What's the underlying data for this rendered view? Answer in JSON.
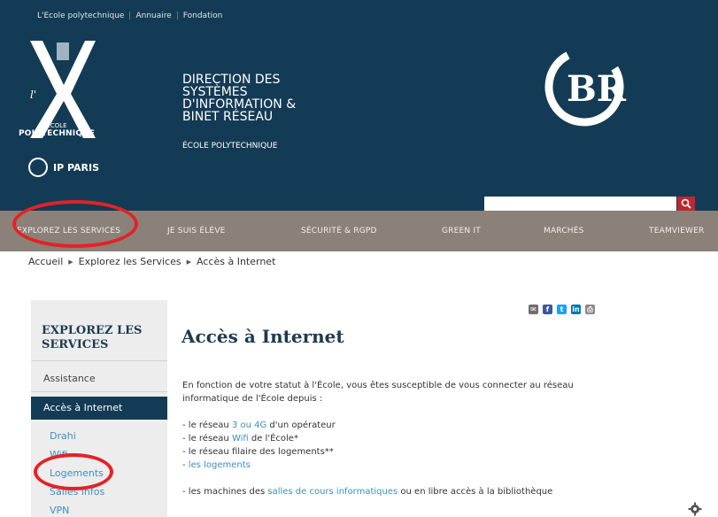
{
  "top_links": [
    "L'Ecole polytechnique",
    "Annuaire",
    "Fondation"
  ],
  "logo": {
    "letter": "X",
    "l_letter": "l'",
    "ecole": "ÉCOLE",
    "polytechnique": "POLYTECHNIQUE",
    "ip_paris": "IP PARIS",
    "br": "BR"
  },
  "header": {
    "title_lines": [
      "DIRECTION DES",
      "SYSTÈMES",
      "D'INFORMATION &",
      "BINET RÉSEAU"
    ],
    "subtitle": "ÉCOLE POLYTECHNIQUE"
  },
  "search": {
    "placeholder": ""
  },
  "nav": [
    "EXPLOREZ LES SERVICES",
    "JE SUIS ÉLÈVE",
    "SÉCURITÉ & RGPD",
    "GREEN IT",
    "MARCHÉS",
    "TEAMVIEWER"
  ],
  "breadcrumb": [
    "Accueil",
    "Explorez les Services",
    "Accès à Internet"
  ],
  "sidebar": {
    "title": "EXPLOREZ LES SERVICES",
    "items": [
      "Assistance",
      "Accès à Internet"
    ],
    "sub_items": [
      "Drahi",
      "Wifi",
      "Logements",
      "Salles infos",
      "VPN"
    ]
  },
  "share_icons": [
    "email-icon",
    "facebook-icon",
    "twitter-icon",
    "linkedin-icon",
    "print-icon"
  ],
  "colors": {
    "header_bg": "#143b55",
    "nav_bg": "#8b8178",
    "link": "#3d8fbd",
    "highlight": "#e32227"
  },
  "content": {
    "title": "Accès à Internet",
    "intro": "En fonction de votre statut à l'École, vous êtes susceptible de vous connecter au réseau informatique de l'École depuis :",
    "list1_prefix": "- le réseau ",
    "list1_link": "3 ou 4G",
    "list1_suffix": " d'un opérateur",
    "list2_prefix": "- le réseau ",
    "list2_link": "Wifi",
    "list2_suffix": " de l'École*",
    "list3": "- le réseau filaire des logements**",
    "list4_prefix": "- ",
    "list4_link": "les logements",
    "machines_prefix": "- les machines des ",
    "machines_link": "salles de cours informatiques",
    "machines_suffix": " ou en libre accès à la bibliothèque"
  }
}
